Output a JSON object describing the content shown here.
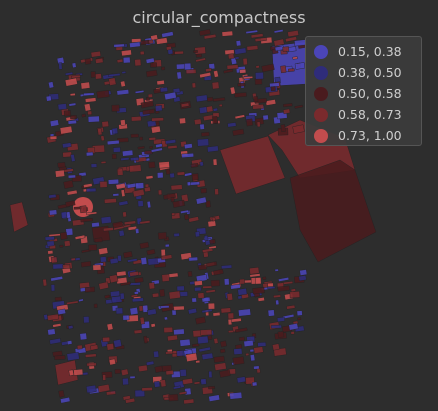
{
  "map": {
    "title": "circular_compactness",
    "background": "#2d2d2d",
    "legend": {
      "items": [
        {
          "label": "0.15, 0.38",
          "color": "#4b45b8"
        },
        {
          "label": "0.38, 0.50",
          "color": "#2f2c7a"
        },
        {
          "label": "0.50, 0.58",
          "color": "#4a1b1e"
        },
        {
          "label": "0.58, 0.73",
          "color": "#7a2a2d"
        },
        {
          "label": "0.73, 1.00",
          "color": "#c24c4d"
        }
      ]
    }
  }
}
